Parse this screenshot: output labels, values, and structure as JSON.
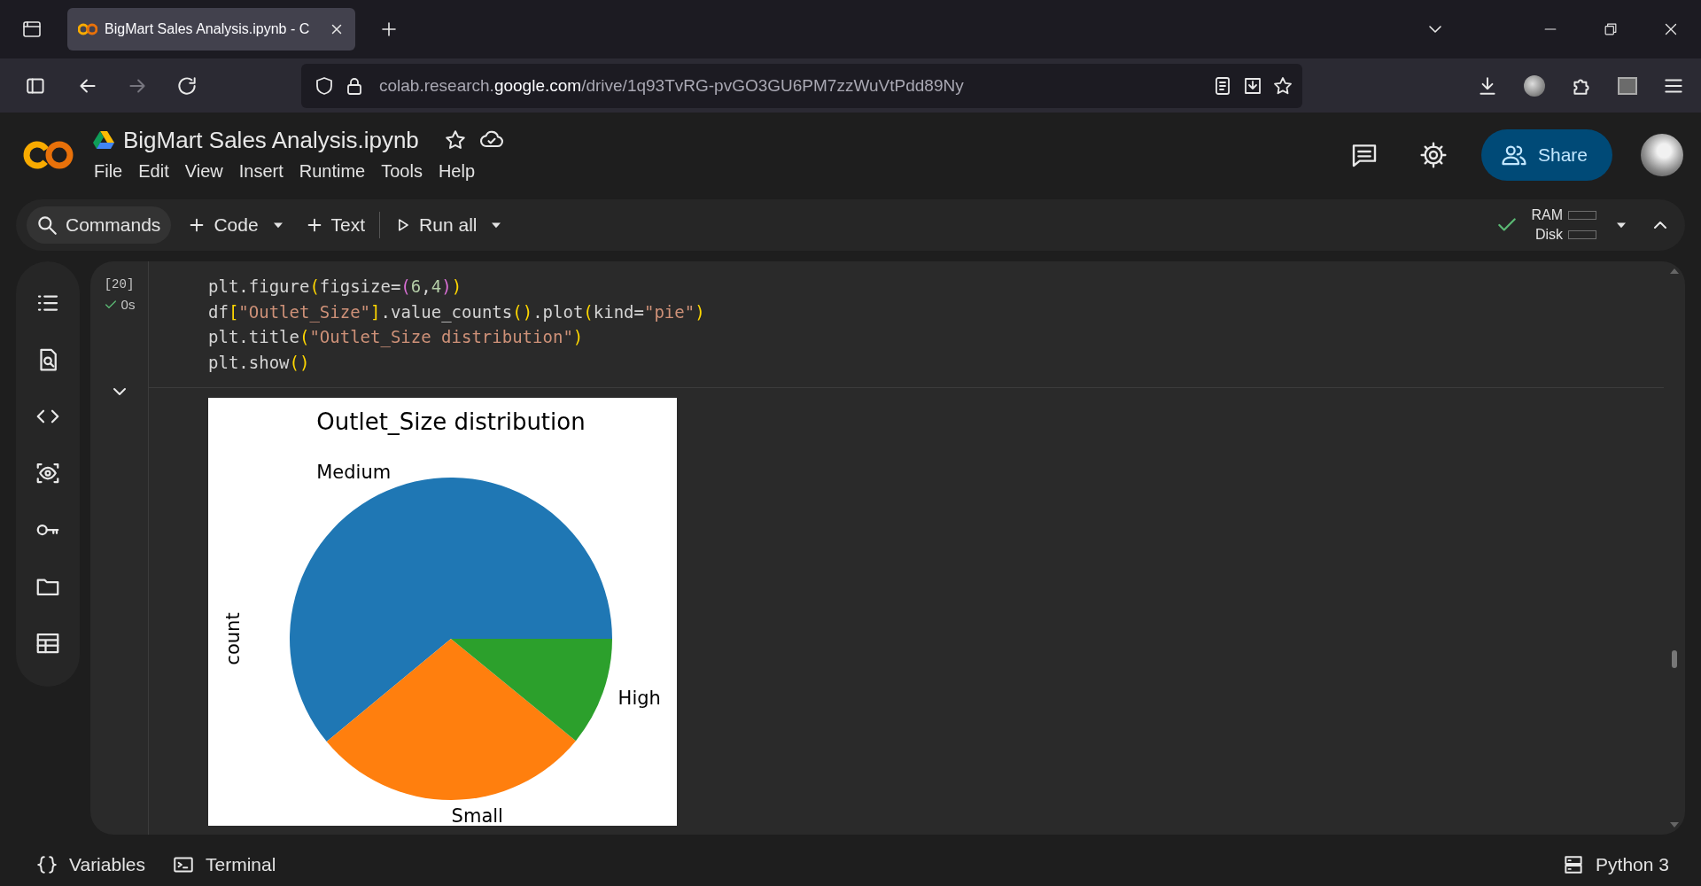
{
  "browser": {
    "tab_title": "BigMart Sales Analysis.ipynb - C",
    "url": [
      {
        "text": "colab.research.",
        "strong": false
      },
      {
        "text": "google.com",
        "strong": true
      },
      {
        "text": "/drive/1q93TvRG-pvGO3GU6PM7zzWuVtPdd89Ny",
        "strong": false
      }
    ]
  },
  "notebook": {
    "title": "BigMart Sales Analysis.ipynb",
    "menu": [
      "File",
      "Edit",
      "View",
      "Insert",
      "Runtime",
      "Tools",
      "Help"
    ],
    "share": "Share"
  },
  "toolbar": {
    "commands": "Commands",
    "add_code": "Code",
    "add_text": "Text",
    "run_all": "Run all",
    "ram": "RAM",
    "disk": "Disk",
    "connected": true
  },
  "cell": {
    "execution_count": "[20]",
    "status": "0s",
    "code": [
      [
        {
          "t": "plt.figure",
          "kind": "plain"
        },
        {
          "t": "(",
          "kind": "bracket1"
        },
        {
          "t": "figsize=",
          "kind": "plain"
        },
        {
          "t": "(",
          "kind": "bracket2"
        },
        {
          "t": "6",
          "kind": "number"
        },
        {
          "t": ",",
          "kind": "plain"
        },
        {
          "t": "4",
          "kind": "number"
        },
        {
          "t": ")",
          "kind": "bracket2"
        },
        {
          "t": ")",
          "kind": "bracket1"
        }
      ],
      [
        {
          "t": "df",
          "kind": "plain"
        },
        {
          "t": "[",
          "kind": "bracket1"
        },
        {
          "t": "\"Outlet_Size\"",
          "kind": "string"
        },
        {
          "t": "]",
          "kind": "bracket1"
        },
        {
          "t": ".value_counts",
          "kind": "plain"
        },
        {
          "t": "()",
          "kind": "bracket1"
        },
        {
          "t": ".plot",
          "kind": "plain"
        },
        {
          "t": "(",
          "kind": "bracket1"
        },
        {
          "t": "kind=",
          "kind": "plain"
        },
        {
          "t": "\"pie\"",
          "kind": "string"
        },
        {
          "t": ")",
          "kind": "bracket1"
        }
      ],
      [
        {
          "t": "plt.title",
          "kind": "plain"
        },
        {
          "t": "(",
          "kind": "bracket1"
        },
        {
          "t": "\"Outlet_Size distribution\"",
          "kind": "string"
        },
        {
          "t": ")",
          "kind": "bracket1"
        }
      ],
      [
        {
          "t": "plt.show",
          "kind": "plain"
        },
        {
          "t": "()",
          "kind": "bracket1"
        }
      ]
    ],
    "output": {
      "chart_data": {
        "type": "pie",
        "title": "Outlet_Size distribution",
        "ylabel": "count",
        "categories": [
          "Medium",
          "Small",
          "High"
        ],
        "values": [
          61.0,
          28.1,
          10.9
        ]
      }
    }
  },
  "status_bar": {
    "variables": "Variables",
    "terminal": "Terminal",
    "kernel": "Python 3"
  }
}
